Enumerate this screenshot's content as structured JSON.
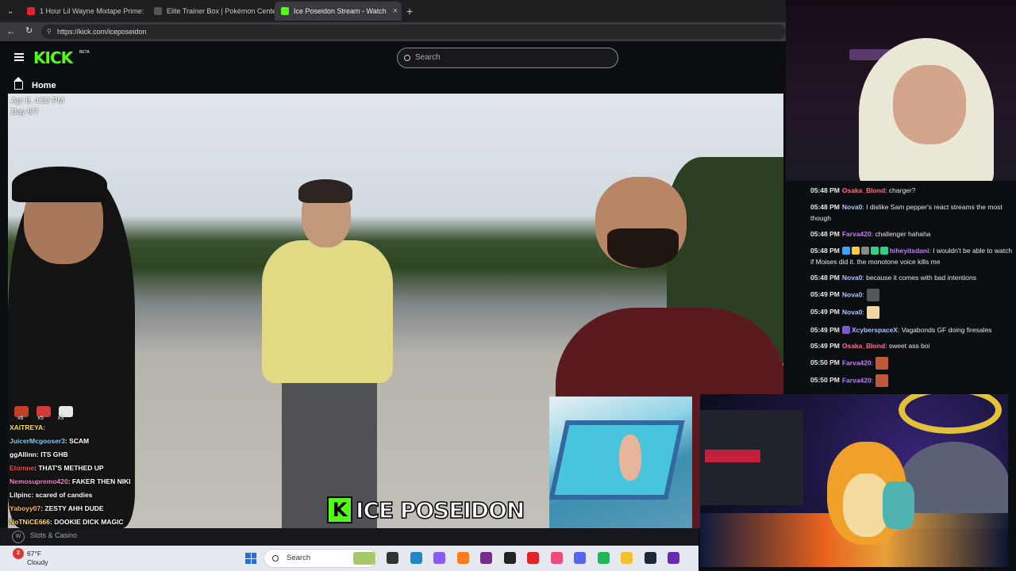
{
  "browser": {
    "tabs": [
      {
        "label": "1 Hour Lil Wayne Mixtape Prime: ",
        "favicon_color": "#e3242b",
        "active": false
      },
      {
        "label": "Elite Trainer Box | Pokémon Cente",
        "favicon_color": "#555555",
        "active": false
      },
      {
        "label": "Ice Poseidon Stream - Watch",
        "favicon_color": "#53fc18",
        "active": true
      }
    ],
    "url": "https://kick.com/iceposeidon"
  },
  "kick": {
    "logo": "KICK",
    "beta": "BETA",
    "search_placeholder": "Search",
    "home_label": "Home",
    "brand_color": "#53fc18"
  },
  "video": {
    "timestamp": "Apr 8, 4:52 PM",
    "day": "Day 6/7",
    "overlay_chat": [
      {
        "user": "XAITREYA:",
        "text": "",
        "color": "#ffe04a"
      },
      {
        "user": "JuicerMcgooser3",
        "text": ": SCAM",
        "color": "#7fd4ff"
      },
      {
        "user": "ggAllinn",
        "text": ": ITS GHB",
        "color": "#ffffff"
      },
      {
        "user": "Etomne",
        "text": ": THAT'S METHED UP",
        "color": "#ff4a4a"
      },
      {
        "user": "Nemosupremo420",
        "text": ": FAKER THEN NIKI",
        "color": "#ff7fd4"
      },
      {
        "user": "Lilpinc",
        "text": ": scared of candies",
        "color": "#ffffff"
      },
      {
        "user": "Yaboyy07",
        "text": ": ZESTY AHH DUDE",
        "color": "#ffb84a"
      },
      {
        "user": "NoTNiCE666",
        "text": ": DOOKIE DICK MAGIC",
        "color": "#ffe04a"
      }
    ],
    "overlay_badges": [
      "x6",
      "x5",
      "x3"
    ],
    "brand_banner_letter": "K",
    "brand_banner_text": "ICE POSEIDON"
  },
  "chat": {
    "messages": [
      {
        "time": "05:48 PM",
        "user": "Osaka_Blond",
        "user_color": "#ff6b8a",
        "text": ": charger?"
      },
      {
        "time": "05:48 PM",
        "user": "Nova0",
        "user_color": "#a7c4ff",
        "text": ": I dislike Sam pepper's react streams the most though"
      },
      {
        "time": "05:48 PM",
        "user": "Farva420",
        "user_color": "#c27dff",
        "text": ": challenger hahaha"
      },
      {
        "time": "05:48 PM",
        "user": "hiheyitsdani",
        "user_color": "#c27dff",
        "text": ": I wouldn't be able to watch if Moises did it. the monotone voice kills me",
        "badges": [
          "#3ba3ff",
          "#ffcc33",
          "#888888",
          "#2fcf8a",
          "#2fcf8a"
        ]
      },
      {
        "time": "05:48 PM",
        "user": "Nova0",
        "user_color": "#a7c4ff",
        "text": ": because it comes with bad intentions"
      },
      {
        "time": "05:49 PM",
        "user": "Nova0",
        "user_color": "#a7c4ff",
        "text": ":",
        "emote": "#555555"
      },
      {
        "time": "05:49 PM",
        "user": "Nova0",
        "user_color": "#a7c4ff",
        "text": ":",
        "emote": "#f2d8a0"
      },
      {
        "time": "05:49 PM",
        "user": "XcyberspaceX",
        "user_color": "#a7c4ff",
        "text": ": Vagabonds GF doing firesales",
        "badges": [
          "#7a5ac8"
        ]
      },
      {
        "time": "05:49 PM",
        "user": "Osaka_Blond",
        "user_color": "#ff6b8a",
        "text": ": sweet ass boi"
      },
      {
        "time": "05:50 PM",
        "user": "Farva420",
        "user_color": "#c27dff",
        "text": ":",
        "emote": "#c0583a"
      },
      {
        "time": "05:50 PM",
        "user": "Farva420",
        "user_color": "#c27dff",
        "text": ":",
        "emote": "#c0583a"
      }
    ]
  },
  "bottom": {
    "slots_label": "Slots & Casino",
    "slots_logo": "W"
  },
  "taskbar": {
    "weather_badge": "2",
    "temp": "67°F",
    "condition": "Cloudy",
    "search_label": "Search",
    "icons": [
      {
        "name": "task-view-icon",
        "color": "#333333"
      },
      {
        "name": "edge-icon",
        "color": "#1e88c7"
      },
      {
        "name": "copilot-icon",
        "color": "#8a5cf6"
      },
      {
        "name": "firefox-icon",
        "color": "#ff7a1a"
      },
      {
        "name": "podcast-icon",
        "color": "#7a2a8a"
      },
      {
        "name": "obs-icon",
        "color": "#222222"
      },
      {
        "name": "app-red-icon",
        "color": "#e3242b"
      },
      {
        "name": "itunes-icon",
        "color": "#f04a7a"
      },
      {
        "name": "discord-icon",
        "color": "#5865f2"
      },
      {
        "name": "spotify-icon",
        "color": "#1db954"
      },
      {
        "name": "file-explorer-icon",
        "color": "#f2c12e"
      },
      {
        "name": "steam-icon",
        "color": "#1b2838"
      },
      {
        "name": "app-purple-icon",
        "color": "#6a2ab8"
      }
    ]
  }
}
